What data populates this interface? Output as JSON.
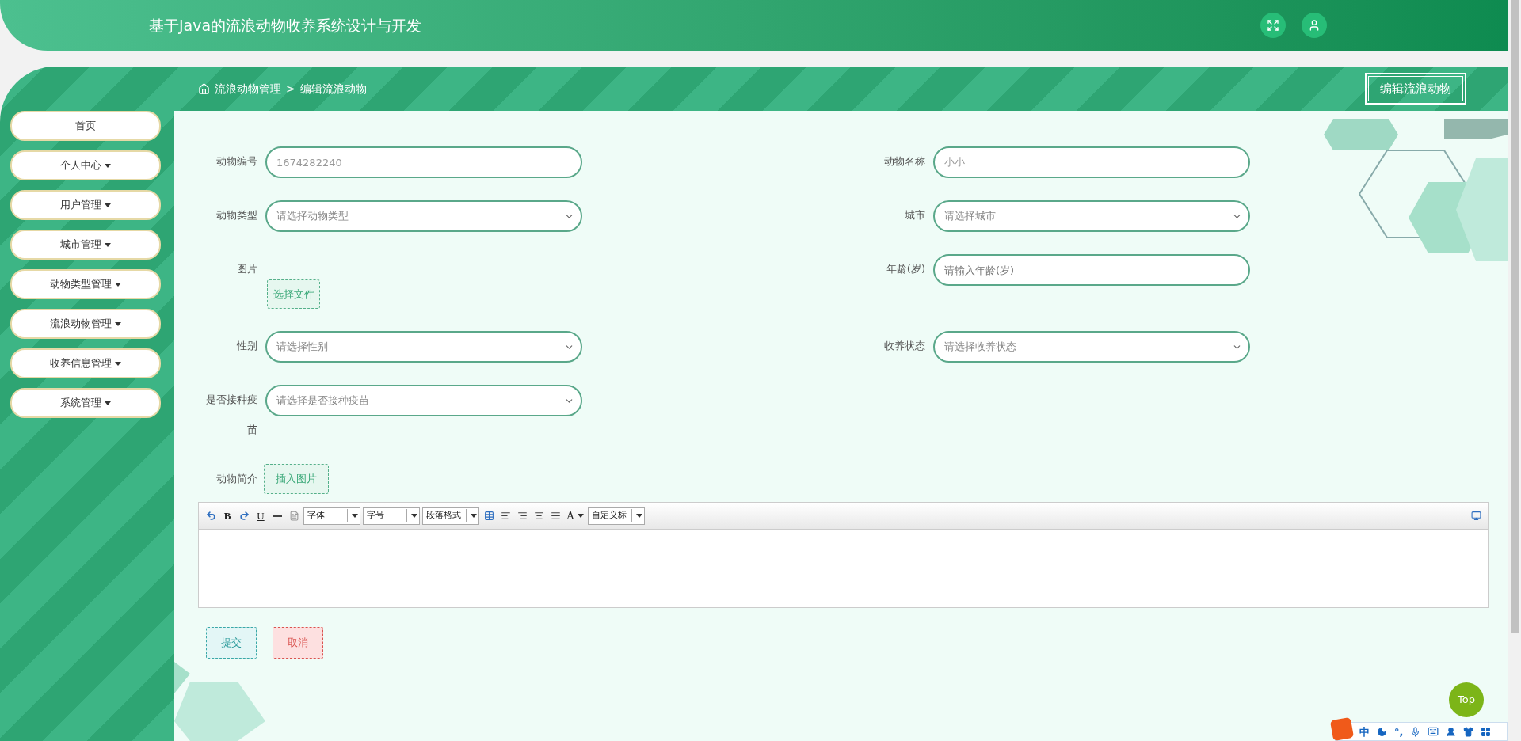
{
  "header": {
    "title": "基于Java的流浪动物收养系统设计与开发"
  },
  "breadcrumb": {
    "items": [
      "流浪动物管理",
      "编辑流浪动物"
    ],
    "separator": ">"
  },
  "page_title": "编辑流浪动物",
  "sidebar": {
    "items": [
      {
        "label": "首页",
        "has_submenu": false
      },
      {
        "label": "个人中心",
        "has_submenu": true
      },
      {
        "label": "用户管理",
        "has_submenu": true
      },
      {
        "label": "城市管理",
        "has_submenu": true
      },
      {
        "label": "动物类型管理",
        "has_submenu": true
      },
      {
        "label": "流浪动物管理",
        "has_submenu": true
      },
      {
        "label": "收养信息管理",
        "has_submenu": true
      },
      {
        "label": "系统管理",
        "has_submenu": true
      }
    ]
  },
  "form": {
    "rows": [
      [
        {
          "label": "动物编号",
          "kind": "text",
          "value": "1674282240"
        },
        {
          "label": "动物名称",
          "kind": "text",
          "value": "小小"
        }
      ],
      [
        {
          "label": "动物类型",
          "kind": "select",
          "placeholder": "请选择动物类型"
        },
        {
          "label": "城市",
          "kind": "select",
          "placeholder": "请选择城市"
        }
      ],
      [
        {
          "label": "图片",
          "kind": "file",
          "button": "选择文件"
        },
        {
          "label": "年龄(岁)",
          "kind": "text",
          "placeholder": "请输入年龄(岁)"
        }
      ],
      [
        {
          "label": "性别",
          "kind": "select",
          "placeholder": "请选择性别"
        },
        {
          "label": "收养状态",
          "kind": "select",
          "placeholder": "请选择收养状态"
        }
      ],
      [
        {
          "label": "是否接种疫苗",
          "kind": "select",
          "placeholder": "请选择是否接种疫苗"
        }
      ]
    ]
  },
  "intro": {
    "label": "动物简介",
    "insert_button": "插入图片"
  },
  "editor": {
    "toolbar": [
      {
        "kind": "undo"
      },
      {
        "kind": "bold",
        "label": "B"
      },
      {
        "kind": "redo"
      },
      {
        "kind": "underline",
        "label": "U"
      },
      {
        "kind": "rule"
      },
      {
        "kind": "document"
      },
      {
        "kind": "select",
        "label": "字体"
      },
      {
        "kind": "select",
        "label": "字号"
      },
      {
        "kind": "select",
        "label": "段落格式"
      },
      {
        "kind": "table"
      },
      {
        "kind": "alignleft"
      },
      {
        "kind": "alignright"
      },
      {
        "kind": "aligncenter"
      },
      {
        "kind": "justify"
      },
      {
        "kind": "color",
        "label": "A"
      },
      {
        "kind": "select",
        "label": "自定义标"
      }
    ],
    "right_tool": {
      "kind": "source"
    }
  },
  "buttons": [
    {
      "label": "提交",
      "kind": "submit"
    },
    {
      "label": "取消",
      "kind": "cancel"
    }
  ],
  "back_to_top": "Top",
  "ime_bar": {
    "items": [
      {
        "kind": "text",
        "label": "中"
      },
      {
        "kind": "moon"
      },
      {
        "kind": "text",
        "label": "°,"
      },
      {
        "kind": "mic"
      },
      {
        "kind": "keyboard"
      },
      {
        "kind": "user"
      },
      {
        "kind": "shirt"
      },
      {
        "kind": "grid"
      }
    ]
  }
}
